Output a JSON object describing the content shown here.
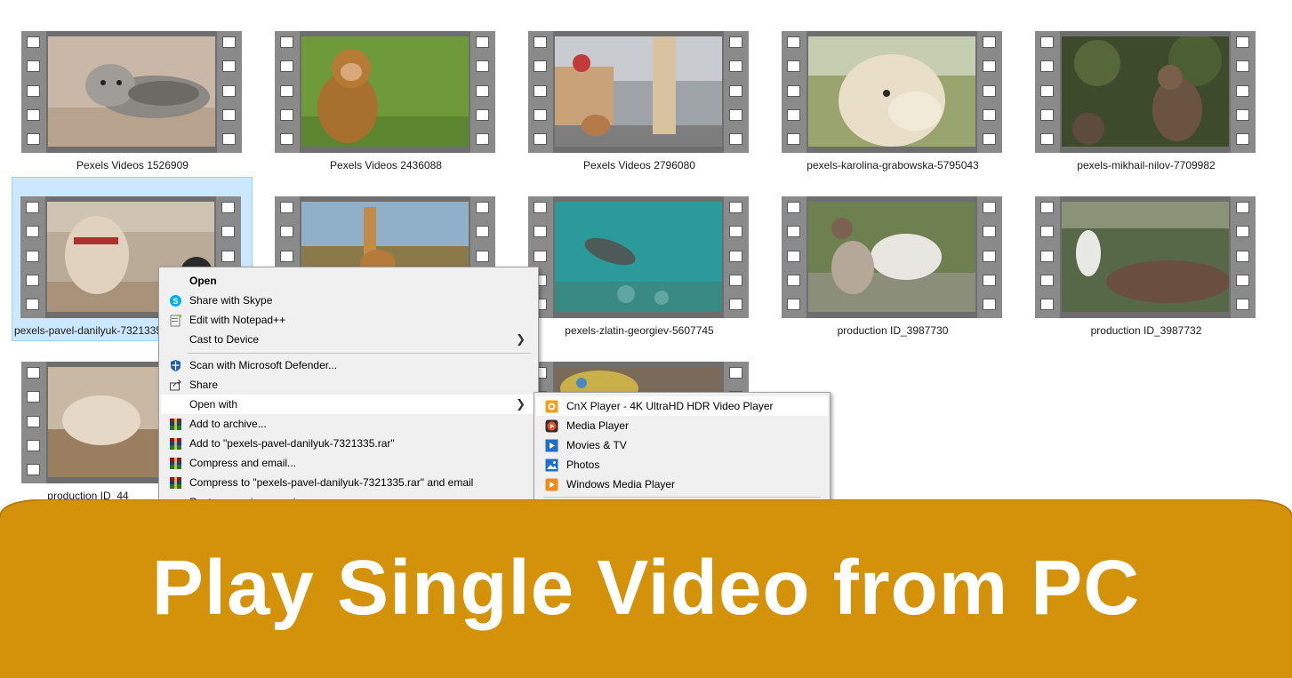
{
  "files": [
    {
      "name": "Pexels Videos 1526909"
    },
    {
      "name": "Pexels Videos 2436088"
    },
    {
      "name": "Pexels Videos 2796080"
    },
    {
      "name": "pexels-karolina-grabowska-5795043"
    },
    {
      "name": "pexels-mikhail-nilov-7709982"
    },
    {
      "name": "pexels-pavel-danilyuk-7321335"
    },
    {
      "name": ""
    },
    {
      "name": "pexels-zlatin-georgiev-5607745"
    },
    {
      "name": "production ID_3987730"
    },
    {
      "name": "production ID_3987732"
    },
    {
      "name": "production ID_44"
    },
    {
      "name": ""
    }
  ],
  "context_menu": {
    "items": [
      {
        "label": "Open",
        "icon": "none"
      },
      {
        "label": "Share with Skype",
        "icon": "skype-icon"
      },
      {
        "label": "Edit with Notepad++",
        "icon": "notepad-plus-plus-icon"
      },
      {
        "label": "Cast to Device",
        "icon": "none"
      },
      {
        "label": "Scan with Microsoft Defender...",
        "icon": "defender-shield-icon"
      },
      {
        "label": "Share",
        "icon": "share-icon"
      },
      {
        "label": "Open with",
        "icon": "none"
      },
      {
        "label": "Add to archive...",
        "icon": "winrar-icon"
      },
      {
        "label": "Add to \"pexels-pavel-danilyuk-7321335.rar\"",
        "icon": "winrar-icon"
      },
      {
        "label": "Compress and email...",
        "icon": "winrar-icon"
      },
      {
        "label": "Compress to \"pexels-pavel-danilyuk-7321335.rar\" and email",
        "icon": "winrar-icon"
      },
      {
        "label": "Restore previous versions",
        "icon": "none"
      }
    ]
  },
  "open_with_submenu": {
    "items": [
      {
        "label": "CnX Player - 4K UltraHD HDR Video Player",
        "icon": "cnx-player-icon"
      },
      {
        "label": "Media Player",
        "icon": "media-player-icon"
      },
      {
        "label": "Movies & TV",
        "icon": "movies-tv-icon"
      },
      {
        "label": "Photos",
        "icon": "photos-icon"
      },
      {
        "label": "Windows Media Player",
        "icon": "windows-media-player-icon"
      }
    ]
  },
  "banner": {
    "title": "Play Single Video from PC",
    "color": "#d4910a"
  }
}
